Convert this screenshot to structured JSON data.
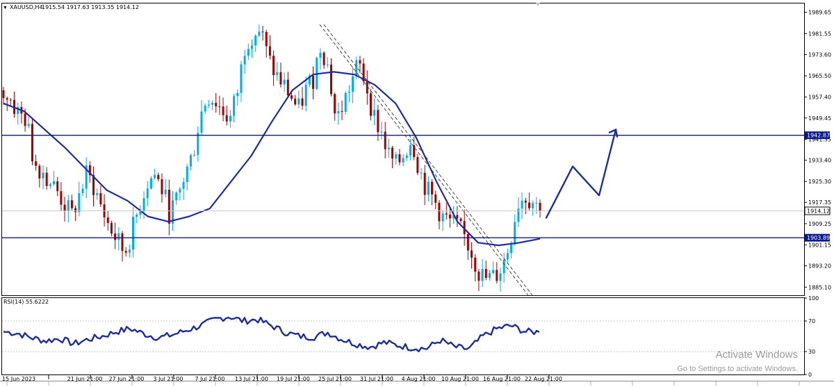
{
  "header": {
    "symbol_label": "XAUUSD,H4",
    "ohlc": "1915.54 1917.63 1913.35 1914.12",
    "collapse_arrow": "triangle-down-icon"
  },
  "rsi_header": {
    "label": "RSI(14) 55.6222"
  },
  "watermark": {
    "title": "Activate Windows",
    "subtitle": "Go to Settings to activate Windows."
  },
  "colors": {
    "bull": "#00aeef",
    "bear": "#a40000",
    "line": "#1c2ba8",
    "horizontal": "#0c1a8c",
    "grid": "#c8c8c8",
    "axis": "#000000"
  },
  "chart_data": [
    {
      "type": "candlestick",
      "symbol": "XAUUSD",
      "timeframe": "H4",
      "ylim": [
        1882,
        1993
      ],
      "yticks": [
        "1989.65",
        "1981.55",
        "1973.60",
        "1965.50",
        "1957.40",
        "1949.45",
        "1941.35",
        "1933.40",
        "1925.30",
        "1917.35",
        "1909.25",
        "1901.15",
        "1893.20",
        "1885.10"
      ],
      "xticks": [
        "15 Jun 2023",
        "21 Jun 21:00",
        "27 Jun 21:00",
        "3 Jul 21:00",
        "7 Jul 21:00",
        "13 Jul 21:00",
        "19 Jul 21:00",
        "25 Jul 21:00",
        "31 Jul 21:00",
        "4 Aug 21:00",
        "10 Aug 21:00",
        "16 Aug 21:00",
        "22 Aug 21:00"
      ],
      "price_labels": [
        {
          "value": 1942.87,
          "text": "1942.87",
          "style": "line"
        },
        {
          "value": 1914.12,
          "text": "1914.12",
          "style": "current"
        },
        {
          "value": 1903.89,
          "text": "1903.89",
          "style": "line"
        }
      ],
      "price_anchors": [
        1960,
        1956,
        1951,
        1949,
        1933,
        1930,
        1926,
        1922,
        1917,
        1912,
        1920,
        1928,
        1923,
        1915,
        1908,
        1903,
        1898,
        1906,
        1916,
        1925,
        1928,
        1922,
        1913,
        1918,
        1928,
        1935,
        1950,
        1958,
        1956,
        1952,
        1949,
        1960,
        1978,
        1982,
        1983,
        1972,
        1966,
        1962,
        1958,
        1952,
        1960,
        1965,
        1978,
        1968,
        1948,
        1955,
        1963,
        1970,
        1962,
        1950,
        1944,
        1935,
        1931,
        1936,
        1942,
        1930,
        1922,
        1918,
        1912,
        1910,
        1908,
        1904,
        1898,
        1890,
        1888,
        1889,
        1893,
        1902,
        1917,
        1920,
        1918,
        1914
      ],
      "moving_average": [
        1955,
        1952,
        1945,
        1938,
        1930,
        1922,
        1918,
        1912,
        1910,
        1912,
        1915,
        1925,
        1935,
        1948,
        1960,
        1966,
        1967,
        1966,
        1962,
        1955,
        1942,
        1925,
        1910,
        1902,
        1901,
        1902,
        1903.5
      ],
      "horizontal_lines": [
        1942.87,
        1903.89
      ],
      "trendline": {
        "from": [
          "25 Jul 21:00",
          1985
        ],
        "to": [
          "22 Aug 21:00",
          1882
        ]
      },
      "projection_path": [
        1911.5,
        1931,
        1920,
        1945
      ]
    },
    {
      "type": "line",
      "title": "RSI(14) 55.6222",
      "ylim": [
        0,
        100
      ],
      "yticks": [
        "100",
        "70",
        "30",
        "0"
      ],
      "levels": [
        70,
        30
      ],
      "anchors": [
        56,
        54,
        48,
        44,
        47,
        40,
        46,
        50,
        56,
        60,
        53,
        48,
        52,
        58,
        64,
        72,
        76,
        70,
        72,
        64,
        55,
        50,
        49,
        55,
        46,
        40,
        36,
        42,
        38,
        35,
        34,
        45,
        36,
        33,
        50,
        60,
        64,
        56,
        55.6
      ]
    }
  ]
}
